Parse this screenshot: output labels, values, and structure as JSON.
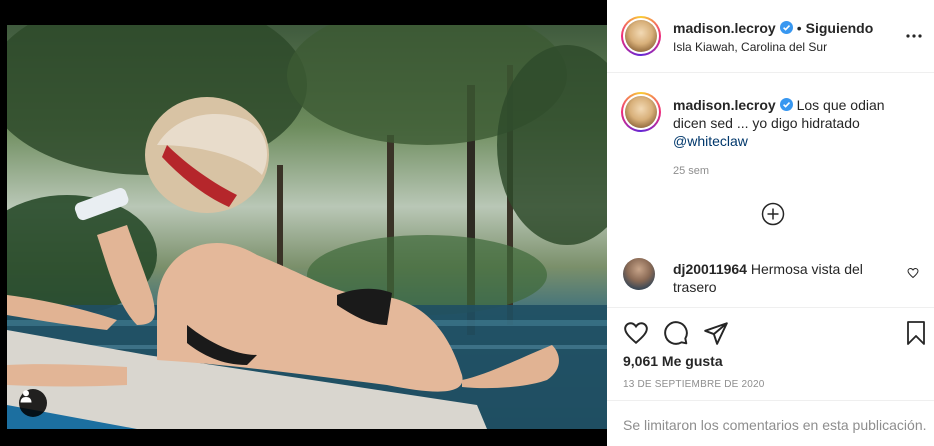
{
  "post": {
    "username": "madison.lecroy",
    "follow_status": "Siguiendo",
    "location": "Isla Kiawah, Carolina del Sur",
    "caption": "Los que odian dicen sed ... yo digo hidratado",
    "caption_mention": "@whiteclaw",
    "time_ago": "25 sem",
    "likes": "9,061 Me gusta",
    "date": "13 DE SEPTIEMBRE DE 2020",
    "comments_limited": "Se limitaron los comentarios en esta publicación."
  },
  "comments": [
    {
      "username": "dj20011964",
      "text": "Hermosa vista del trasero"
    }
  ],
  "colors": {
    "verified": "#3897f0",
    "text": "#262626",
    "muted": "#8e8e8e",
    "mention": "#00376b"
  },
  "icons": [
    "more-options-icon",
    "verified-badge-icon",
    "load-more-comments-icon",
    "heart-icon",
    "comment-icon",
    "share-icon",
    "bookmark-icon",
    "user-tag-icon"
  ]
}
